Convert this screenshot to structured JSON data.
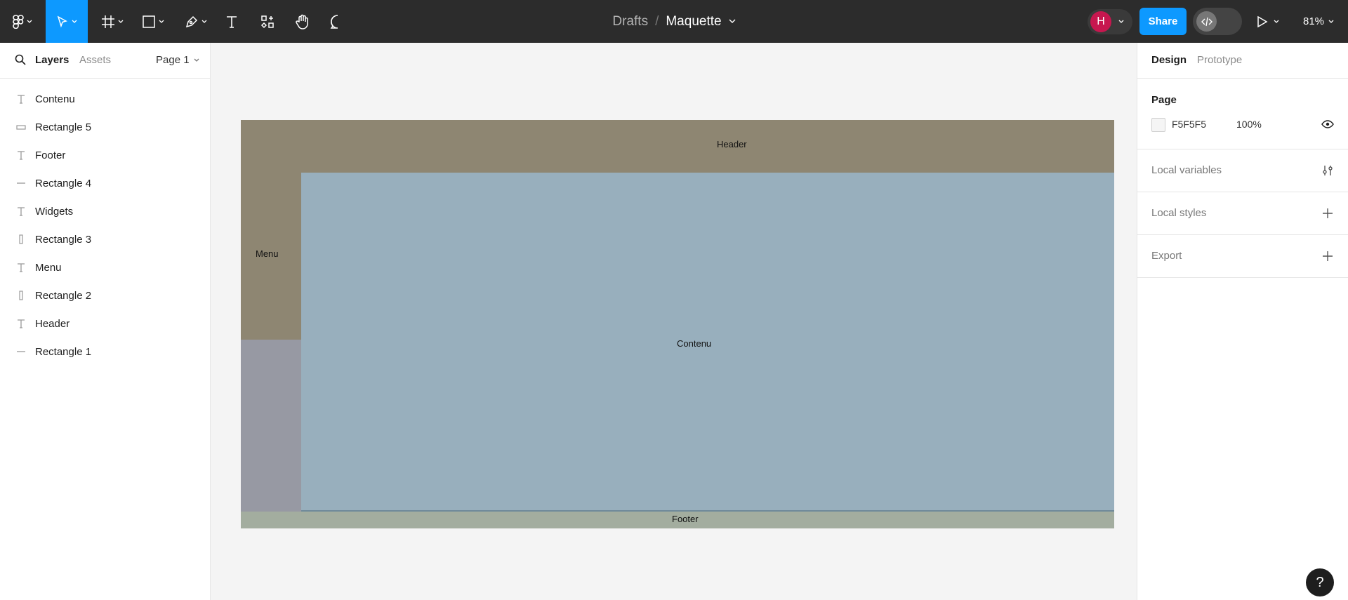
{
  "toolbar": {
    "breadcrumb_root": "Drafts",
    "breadcrumb_sep": "/",
    "file_name": "Maquette",
    "avatar_initial": "H",
    "avatar_color": "#c7174f",
    "share_label": "Share",
    "share_color": "#0d99ff",
    "zoom": "81%",
    "tools": [
      "main-menu",
      "move",
      "frame",
      "shape",
      "pen",
      "text",
      "resources",
      "hand",
      "comment"
    ]
  },
  "left_panel": {
    "tabs": {
      "layers": "Layers",
      "assets": "Assets"
    },
    "page_selector": "Page 1",
    "layers": [
      {
        "label": "Contenu",
        "icon": "text-icon"
      },
      {
        "label": "Rectangle 5",
        "icon": "rectangle-icon"
      },
      {
        "label": "Footer",
        "icon": "text-icon"
      },
      {
        "label": "Rectangle 4",
        "icon": "line-rectangle-icon"
      },
      {
        "label": "Widgets",
        "icon": "text-icon"
      },
      {
        "label": "Rectangle 3",
        "icon": "tall-rectangle-icon"
      },
      {
        "label": "Menu",
        "icon": "text-icon"
      },
      {
        "label": "Rectangle 2",
        "icon": "tall-rectangle-icon"
      },
      {
        "label": "Header",
        "icon": "text-icon"
      },
      {
        "label": "Rectangle 1",
        "icon": "line-rectangle-icon"
      }
    ]
  },
  "canvas": {
    "header_text": "Header",
    "menu_text": "Menu",
    "content_text": "Contenu",
    "footer_text": "Footer",
    "colors": {
      "header": "#8e8672",
      "menu": "#8e8672",
      "sidebar_lower": "#9799a3",
      "content": "#98afbd",
      "footer": "#a3ad9f"
    }
  },
  "right_panel": {
    "tabs": {
      "design": "Design",
      "prototype": "Prototype"
    },
    "page_section": {
      "title": "Page",
      "color_hex": "F5F5F5",
      "opacity": "100%"
    },
    "local_variables": "Local variables",
    "local_styles": "Local styles",
    "export": "Export"
  },
  "help_label": "?"
}
